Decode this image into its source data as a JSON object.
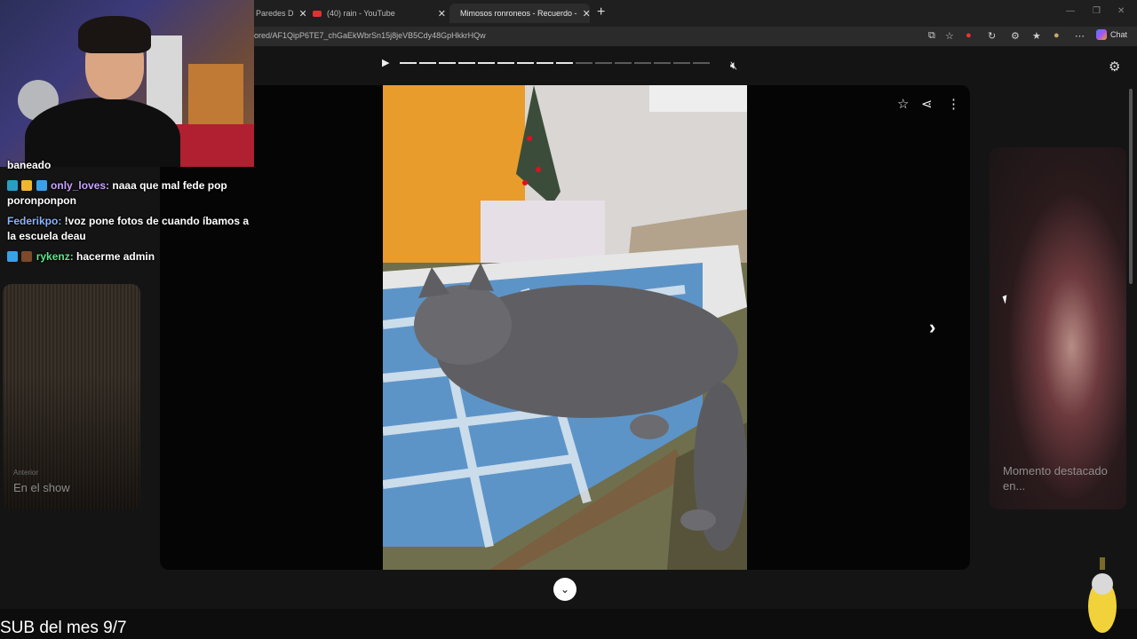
{
  "browser": {
    "tabs": [
      {
        "label": "Paredes D",
        "active": false
      },
      {
        "label": "(40) rain - YouTube",
        "active": false
      },
      {
        "label": "Mimosos ronroneos - Recuerdo -",
        "active": true
      }
    ],
    "url": "ored/AF1QipP6TE7_chGaEkWbrSn15j8jeVB5Cdy48GpHkkrHQw",
    "chat_label": "Chat"
  },
  "player": {
    "segments_total": 16,
    "segments_done": 9
  },
  "viewer": {
    "left_card": {
      "subtitle": "Anterior",
      "title": "En el show"
    },
    "right_card": {
      "title": "Momento destacado en..."
    }
  },
  "chat": [
    {
      "user": "",
      "text": "baneado"
    },
    {
      "user": "only_loves:",
      "text": " naaa que mal fede pop poronponpon",
      "user_color": "#c9a3ff"
    },
    {
      "user": "Federikpo:",
      "text": " !voz pone fotos de cuando íbamos a la escuela deau",
      "user_color": "#8ab4ff"
    },
    {
      "user": "rykenz:",
      "text": " hacerme admin",
      "user_color": "#5fe38a"
    }
  ],
  "overlay": {
    "sub_text": "SUB del mes 9/7"
  },
  "icons": [
    "play-icon",
    "mute-icon",
    "settings-icon",
    "star-icon",
    "share-icon",
    "more-icon",
    "chevron-right-icon",
    "chevron-down-icon"
  ]
}
